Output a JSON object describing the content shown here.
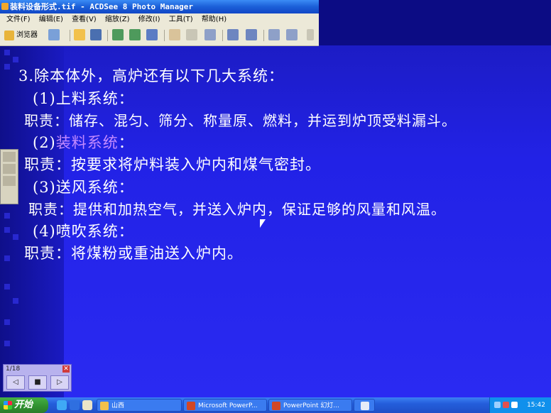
{
  "window": {
    "title": "装料设备形式.tif - ACDSee 8 Photo Manager"
  },
  "menu": [
    "文件(F)",
    "编辑(E)",
    "查看(V)",
    "缩放(Z)",
    "修改(I)",
    "工具(T)",
    "帮助(H)"
  ],
  "toolbar": {
    "browser_label": "浏览器"
  },
  "slide": {
    "heading": "3.除本体外，高炉还有以下几大系统：",
    "item1_title": "(1)上料系统：",
    "item1_duty": "职责：储存、混匀、筛分、称量原、燃料，并运到炉顶受料漏斗。",
    "item2_prefix": "(2)",
    "item2_highlight": "装料系统",
    "item2_suffix": "：",
    "item2_duty": "职责：按要求将炉料装入炉内和煤气密封。",
    "item3_title": "(3)送风系统：",
    "item3_duty": "职责：提供和加热空气，并送入炉内，保证足够的风量和风温。",
    "item4_title": "(4)喷吹系统：",
    "item4_duty": "职责：将煤粉或重油送入炉内。"
  },
  "show_control": {
    "counter": "1/18",
    "close": "✕",
    "prev": "◁",
    "stop": "■",
    "next": "▷"
  },
  "taskbar": {
    "start_label": "开始",
    "tasks": [
      "山西",
      "Microsoft PowerP...",
      "PowerPoint 幻灯..."
    ],
    "clock": "15:42"
  },
  "colors": {
    "slide_blue": "#2222e6",
    "highlight_purple": "#c58bff",
    "taskbar_blue": "#245edb",
    "start_green": "#2f8f2f"
  }
}
